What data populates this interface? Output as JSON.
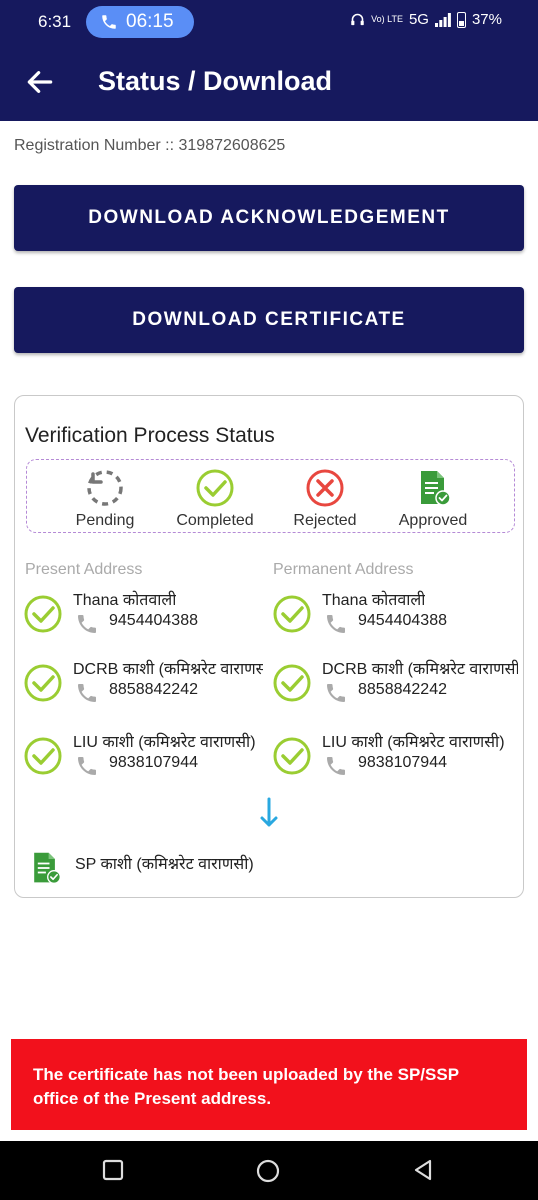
{
  "status_bar": {
    "time": "6:31",
    "call_timer": "06:15",
    "network_small": "Vo) LTE",
    "network": "5G",
    "battery": "37%"
  },
  "app_bar": {
    "title": "Status / Download"
  },
  "registration": {
    "label": "Registration Number :: 319872608625"
  },
  "buttons": {
    "download_ack": "DOWNLOAD ACKNOWLEDGEMENT",
    "download_cert": "DOWNLOAD CERTIFICATE"
  },
  "verification": {
    "title": "Verification Process Status",
    "legend": {
      "pending": "Pending",
      "completed": "Completed",
      "rejected": "Rejected",
      "approved": "Approved"
    },
    "present_heading": "Present Address",
    "permanent_heading": "Permanent Address",
    "present": [
      {
        "office": "Thana कोतवाली",
        "phone": "9454404388"
      },
      {
        "office": "DCRB काशी (कमिश्नरेट वाराणसी)",
        "phone": "8858842242"
      },
      {
        "office": "LIU काशी (कमिश्नरेट वाराणसी)",
        "phone": "9838107944"
      }
    ],
    "permanent": [
      {
        "office": "Thana कोतवाली",
        "phone": "9454404388"
      },
      {
        "office": "DCRB काशी (कमिश्नरेट वाराणसी)",
        "phone": "8858842242"
      },
      {
        "office": "LIU काशी (कमिश्नरेट वाराणसी)",
        "phone": "9838107944"
      }
    ],
    "final_office": "SP काशी (कमिश्नरेट वाराणसी)"
  },
  "error_message": "The certificate has not been uploaded by the SP/SSP office of the Present address.",
  "colors": {
    "primary": "#16195e",
    "check_green": "#9acd32",
    "reject_red": "#e8473f",
    "arrow_blue": "#29a8e0",
    "error_red": "#f2111c"
  }
}
